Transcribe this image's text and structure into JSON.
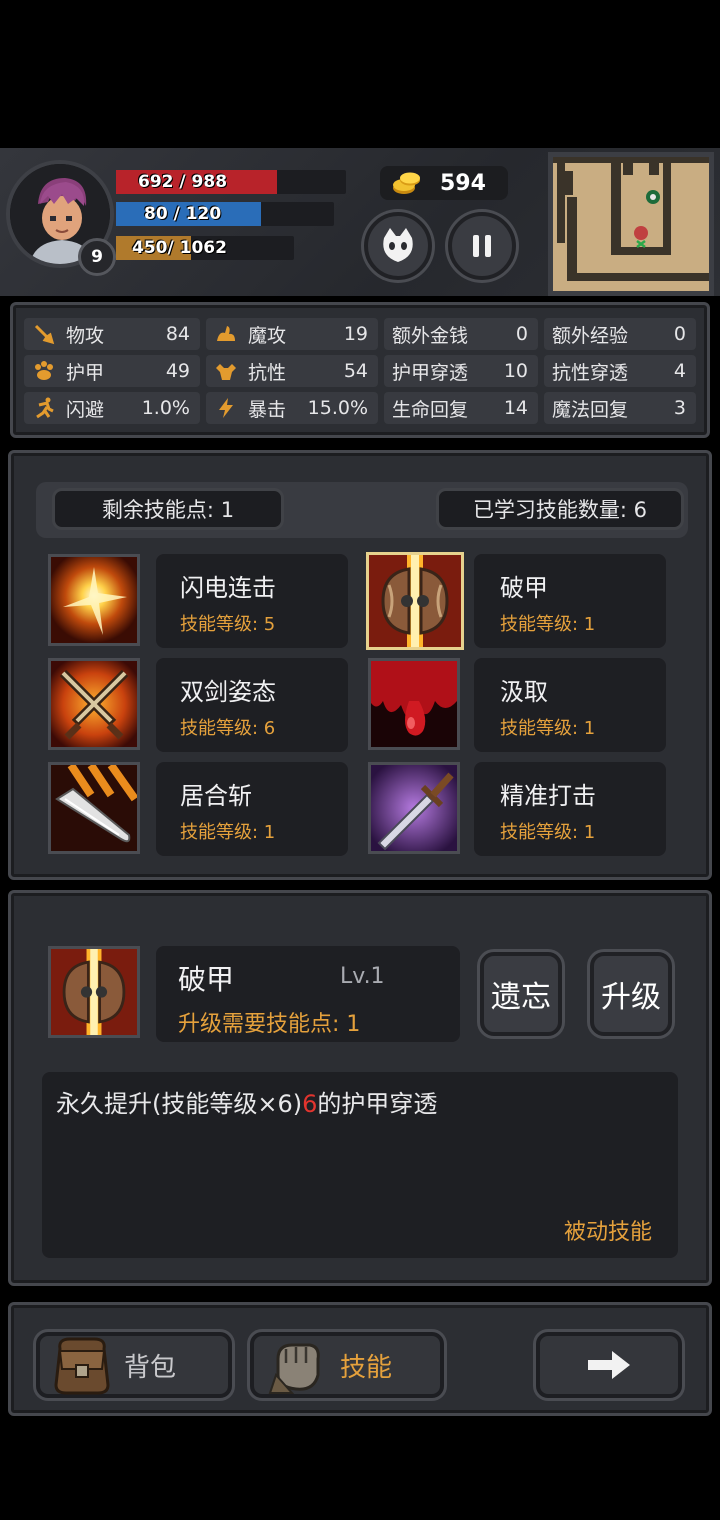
{
  "hud": {
    "hp_text": "692 / 988",
    "hp_ratio": 0.7,
    "mp_text": "80 / 120",
    "mp_ratio": 0.667,
    "xp_current": "450",
    "xp_total": " / 1062",
    "xp_ratio": 0.424,
    "level": "9",
    "gold": "594",
    "colors": {
      "hp": "#b8232a",
      "mp": "#2a6db8",
      "xp": "#b07a2c"
    }
  },
  "stats": [
    {
      "icon": "sword-icon",
      "label": "物攻",
      "value": "84"
    },
    {
      "icon": "hand-magic-icon",
      "label": "魔攻",
      "value": "19"
    },
    {
      "icon": "",
      "label": "额外金钱",
      "value": "0"
    },
    {
      "icon": "",
      "label": "额外经验",
      "value": "0"
    },
    {
      "icon": "paw-armor-icon",
      "label": "护甲",
      "value": "49"
    },
    {
      "icon": "muscle-icon",
      "label": "抗性",
      "value": "54"
    },
    {
      "icon": "",
      "label": "护甲穿透",
      "value": "10"
    },
    {
      "icon": "",
      "label": "抗性穿透",
      "value": "4"
    },
    {
      "icon": "runner-icon",
      "label": "闪避",
      "value": "1.0%"
    },
    {
      "icon": "lightning-icon",
      "label": "暴击",
      "value": "15.0%"
    },
    {
      "icon": "",
      "label": "生命回复",
      "value": "14"
    },
    {
      "icon": "",
      "label": "魔法回复",
      "value": "3"
    }
  ],
  "skills_panel": {
    "remaining_points": "剩余技能点: 1",
    "learned_count": "已学习技能数量: 6",
    "skills": [
      {
        "name": "闪电连击",
        "level": "技能等级: 5",
        "icon": "lightning-burst-icon",
        "selected": false
      },
      {
        "name": "破甲",
        "level": "技能等级: 1",
        "icon": "shield-break-icon",
        "selected": true
      },
      {
        "name": "双剑姿态",
        "level": "技能等级: 6",
        "icon": "crossed-swords-icon",
        "selected": false
      },
      {
        "name": "汲取",
        "level": "技能等级: 1",
        "icon": "blood-drain-icon",
        "selected": false
      },
      {
        "name": "居合斩",
        "level": "技能等级: 1",
        "icon": "blade-slash-icon",
        "selected": false
      },
      {
        "name": "精准打击",
        "level": "技能等级: 1",
        "icon": "precise-sword-icon",
        "selected": false
      }
    ]
  },
  "detail": {
    "name": "破甲",
    "level": "Lv.1",
    "upgrade_cost": "升级需要技能点: 1",
    "forget_label": "遗忘",
    "upgrade_label": "升级",
    "desc_prefix": "永久提升(技能等级×6)",
    "desc_value": "6",
    "desc_suffix": "的护甲穿透",
    "type": "被动技能"
  },
  "nav": {
    "bag_label": "背包",
    "skill_label": "技能",
    "accent": "#e5a13c"
  }
}
